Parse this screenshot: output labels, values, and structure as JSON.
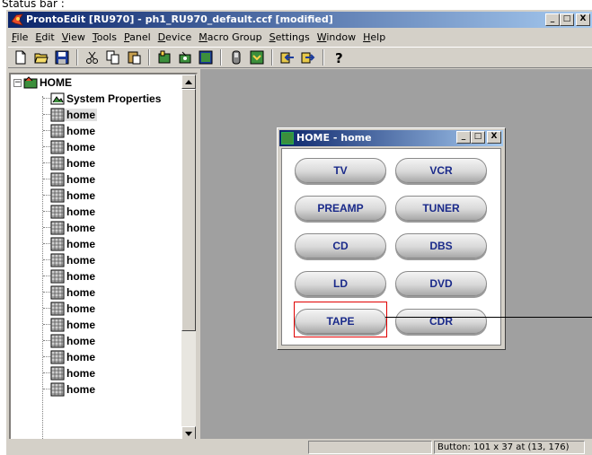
{
  "caption": "Status bar :",
  "window": {
    "title": "ProntoEdit [RU970] - ph1_RU970_default.ccf [modified]"
  },
  "caption_buttons": {
    "minimize": "_",
    "maximize": "□",
    "close": "X"
  },
  "menu": [
    {
      "underline": "F",
      "rest": "ile"
    },
    {
      "underline": "E",
      "rest": "dit"
    },
    {
      "underline": "V",
      "rest": "iew"
    },
    {
      "underline": "T",
      "rest": "ools"
    },
    {
      "underline": "P",
      "rest": "anel"
    },
    {
      "underline": "D",
      "rest": "evice"
    },
    {
      "underline": "M",
      "rest": "acro Group"
    },
    {
      "underline": "S",
      "rest": "ettings"
    },
    {
      "underline": "W",
      "rest": "indow"
    },
    {
      "underline": "H",
      "rest": "elp"
    }
  ],
  "toolbar": {
    "icons": [
      "new-icon",
      "open-icon",
      "save-icon",
      "sep",
      "cut-icon",
      "copy-icon",
      "paste-icon",
      "sep",
      "new-device-icon",
      "new-panel-icon",
      "properties-icon",
      "sep",
      "remote-icon",
      "download-icon",
      "sep",
      "import-icon",
      "export-icon",
      "sep",
      "help-icon"
    ]
  },
  "tree": {
    "root_label": "HOME",
    "system_properties": "System Properties",
    "pages": [
      "home",
      "home",
      "home",
      "home",
      "home",
      "home",
      "home",
      "home",
      "home",
      "home",
      "home",
      "home",
      "home",
      "home",
      "home",
      "home",
      "home",
      "home"
    ]
  },
  "child_window": {
    "title": "HOME - home",
    "buttons": [
      {
        "label": "TV"
      },
      {
        "label": "VCR"
      },
      {
        "label": "PREAMP"
      },
      {
        "label": "TUNER"
      },
      {
        "label": "CD"
      },
      {
        "label": "DBS"
      },
      {
        "label": "LD"
      },
      {
        "label": "DVD"
      },
      {
        "label": "TAPE"
      },
      {
        "label": "CDR"
      }
    ]
  },
  "status": {
    "cell1": "",
    "cell2": "",
    "cell3": "Button: 101 x 37 at (13, 176)"
  },
  "colors": {
    "titlebar": "#0a246a",
    "selection": "#e00000",
    "button_text": "#1a2a8a"
  }
}
